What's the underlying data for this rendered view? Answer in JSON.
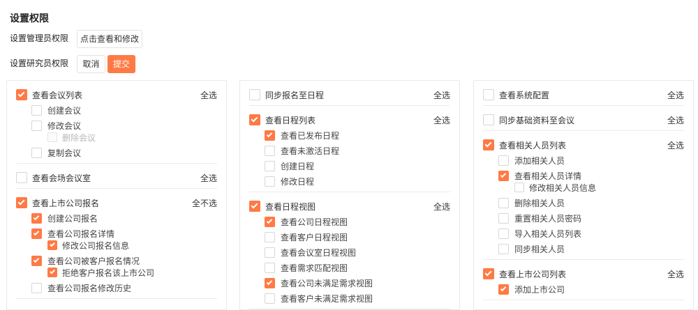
{
  "page": {
    "title": "设置权限"
  },
  "admin": {
    "label": "设置管理员权限",
    "button": "点击查看和修改"
  },
  "researcher": {
    "label": "设置研究员权限",
    "cancel": "取消",
    "submit": "提交"
  },
  "colors": {
    "accent": "#ff7a45"
  },
  "panels": [
    {
      "groups": [
        {
          "label": "查看会议列表",
          "checked": true,
          "action": "全选",
          "items": [
            {
              "label": "创建会议",
              "checked": false
            },
            {
              "label": "修改会议",
              "checked": false,
              "children": [
                {
                  "label": "删除会议",
                  "checked": false,
                  "disabled": true
                }
              ]
            },
            {
              "label": "复制会议",
              "checked": false
            }
          ]
        },
        {
          "label": "查看会场会议室",
          "checked": false,
          "action": "全选",
          "items": []
        },
        {
          "label": "查看上市公司报名",
          "checked": true,
          "action": "全不选",
          "items": [
            {
              "label": "创建公司报名",
              "checked": true
            },
            {
              "label": "查看公司报名详情",
              "checked": true,
              "children": [
                {
                  "label": "修改公司报名信息",
                  "checked": true
                }
              ]
            },
            {
              "label": "查看公司被客户报名情况",
              "checked": true,
              "children": [
                {
                  "label": "拒绝客户报名该上市公司",
                  "checked": true
                }
              ]
            },
            {
              "label": "查看公司报名修改历史",
              "checked": false
            }
          ]
        }
      ]
    },
    {
      "groups": [
        {
          "label": "同步报名至日程",
          "checked": false,
          "action": "全选",
          "items": []
        },
        {
          "label": "查看日程列表",
          "checked": true,
          "action": "全选",
          "items": [
            {
              "label": "查看已发布日程",
              "checked": true
            },
            {
              "label": "查看未激活日程",
              "checked": false
            },
            {
              "label": "创建日程",
              "checked": false
            },
            {
              "label": "修改日程",
              "checked": false
            }
          ]
        },
        {
          "label": "查看日程视图",
          "checked": true,
          "action": "全选",
          "items": [
            {
              "label": "查看公司日程视图",
              "checked": true
            },
            {
              "label": "查看客户日程视图",
              "checked": false
            },
            {
              "label": "查看会议室日程视图",
              "checked": false
            },
            {
              "label": "查看需求匹配视图",
              "checked": false
            },
            {
              "label": "查看公司未满足需求视图",
              "checked": true
            },
            {
              "label": "查看客户未满足需求视图",
              "checked": false
            }
          ]
        }
      ]
    },
    {
      "groups": [
        {
          "label": "查看系统配置",
          "checked": false,
          "action": "全选",
          "items": []
        },
        {
          "label": "同步基础资料至会议",
          "checked": false,
          "action": "全选",
          "items": []
        },
        {
          "label": "查看相关人员列表",
          "checked": true,
          "action": "全选",
          "items": [
            {
              "label": "添加相关人员",
              "checked": false
            },
            {
              "label": "查看相关人员详情",
              "checked": true,
              "children": [
                {
                  "label": "修改相关人员信息",
                  "checked": false
                }
              ]
            },
            {
              "label": "删除相关人员",
              "checked": false
            },
            {
              "label": "重置相关人员密码",
              "checked": false
            },
            {
              "label": "导入相关人员列表",
              "checked": false
            },
            {
              "label": "同步相关人员",
              "checked": false
            }
          ]
        },
        {
          "label": "查看上市公司列表",
          "checked": true,
          "action": "全选",
          "items": [
            {
              "label": "添加上市公司",
              "checked": true
            }
          ]
        }
      ]
    }
  ]
}
